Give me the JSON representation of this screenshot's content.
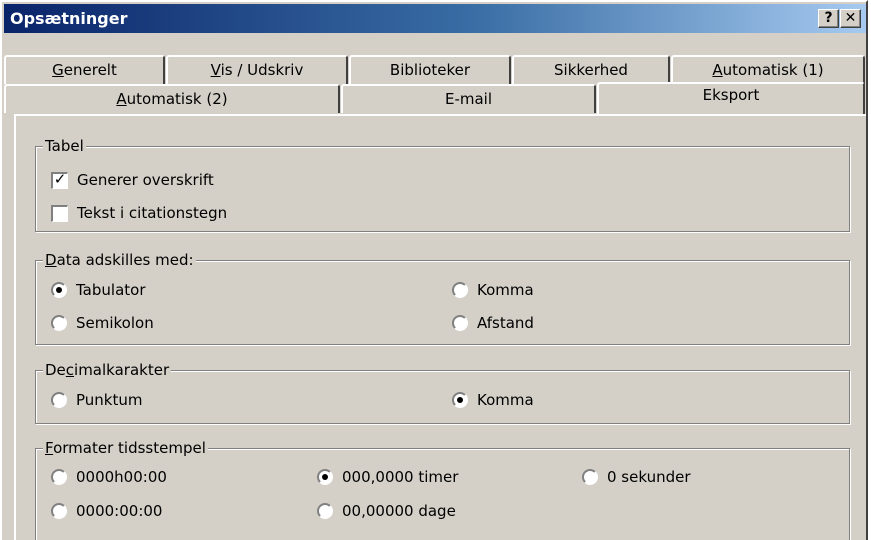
{
  "window": {
    "title": "Opsætninger",
    "help_button": "?",
    "close_button": "✕"
  },
  "tabs": {
    "row1": [
      {
        "label_pre": "",
        "accel": "G",
        "label_post": "enerelt"
      },
      {
        "label_pre": "",
        "accel": "V",
        "label_post": "is / Udskriv"
      },
      {
        "label_pre": "Biblioteker",
        "accel": "",
        "label_post": ""
      },
      {
        "label_pre": "Sikkerhed",
        "accel": "",
        "label_post": ""
      },
      {
        "label_pre": "",
        "accel": "A",
        "label_post": "utomatisk (1)"
      }
    ],
    "row2": [
      {
        "label_pre": "",
        "accel": "A",
        "label_post": "utomatisk (2)"
      },
      {
        "label_pre": "E-mail",
        "accel": "",
        "label_post": ""
      },
      {
        "label_pre": "Eksport",
        "accel": "",
        "label_post": "",
        "active": true
      }
    ]
  },
  "tabel": {
    "legend": "Tabel",
    "generer_overskrift": {
      "label": "Generer overskrift",
      "checked": true
    },
    "tekst_citation": {
      "label": "Tekst i citationstegn",
      "checked": false
    }
  },
  "data_adskilles": {
    "legend_accel": "D",
    "legend_rest": "ata adskilles med:",
    "options": [
      {
        "label": "Tabulator",
        "selected": true
      },
      {
        "label": "Komma",
        "selected": false
      },
      {
        "label": "Semikolon",
        "selected": false
      },
      {
        "label": "Afstand",
        "selected": false
      }
    ]
  },
  "decimal": {
    "legend_pre": "De",
    "legend_accel": "c",
    "legend_rest": "imalkarakter",
    "options": [
      {
        "label": "Punktum",
        "selected": false
      },
      {
        "label": "Komma",
        "selected": true
      }
    ]
  },
  "tidsstempel": {
    "legend_accel": "F",
    "legend_rest": "ormater tidsstempel",
    "options": [
      {
        "label": "0000h00:00",
        "selected": false
      },
      {
        "label": "000,0000 timer",
        "selected": true
      },
      {
        "label": "0 sekunder",
        "selected": false
      },
      {
        "label": "0000:00:00",
        "selected": false
      },
      {
        "label": "00,00000 dage",
        "selected": false
      }
    ]
  }
}
